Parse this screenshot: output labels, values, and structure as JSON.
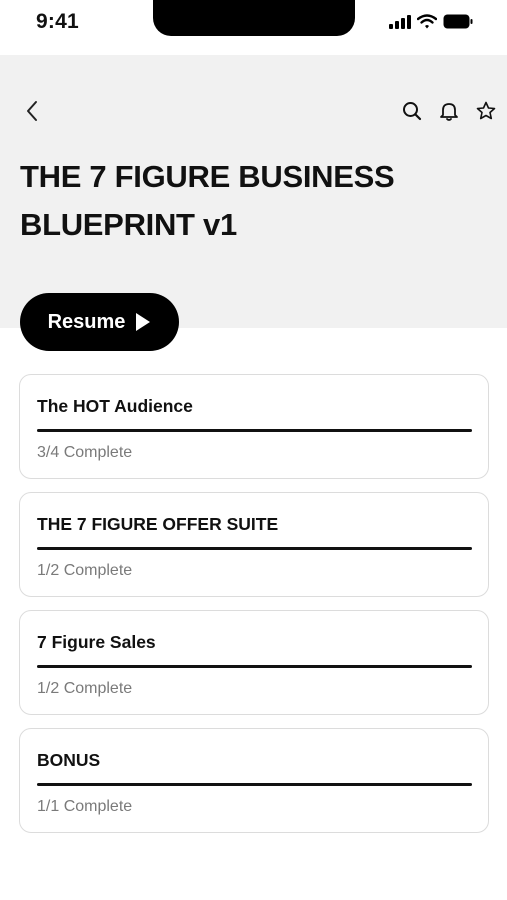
{
  "status_bar": {
    "time": "9:41"
  },
  "header": {
    "title": "THE 7 FIGURE BUSINESS BLUEPRINT v1",
    "back_icon": "chevron-left-icon",
    "actions": [
      "search-icon",
      "bell-icon",
      "star-icon"
    ]
  },
  "resume": {
    "label": "Resume",
    "icon": "play-icon"
  },
  "modules": [
    {
      "title": "The HOT Audience",
      "status": "3/4 Complete",
      "progress": 1.0
    },
    {
      "title": "THE 7 FIGURE OFFER SUITE",
      "status": "1/2 Complete",
      "progress": 1.0
    },
    {
      "title": "7 Figure Sales",
      "status": "1/2 Complete",
      "progress": 1.0
    },
    {
      "title": "BONUS",
      "status": "1/1 Complete",
      "progress": 1.0
    }
  ]
}
